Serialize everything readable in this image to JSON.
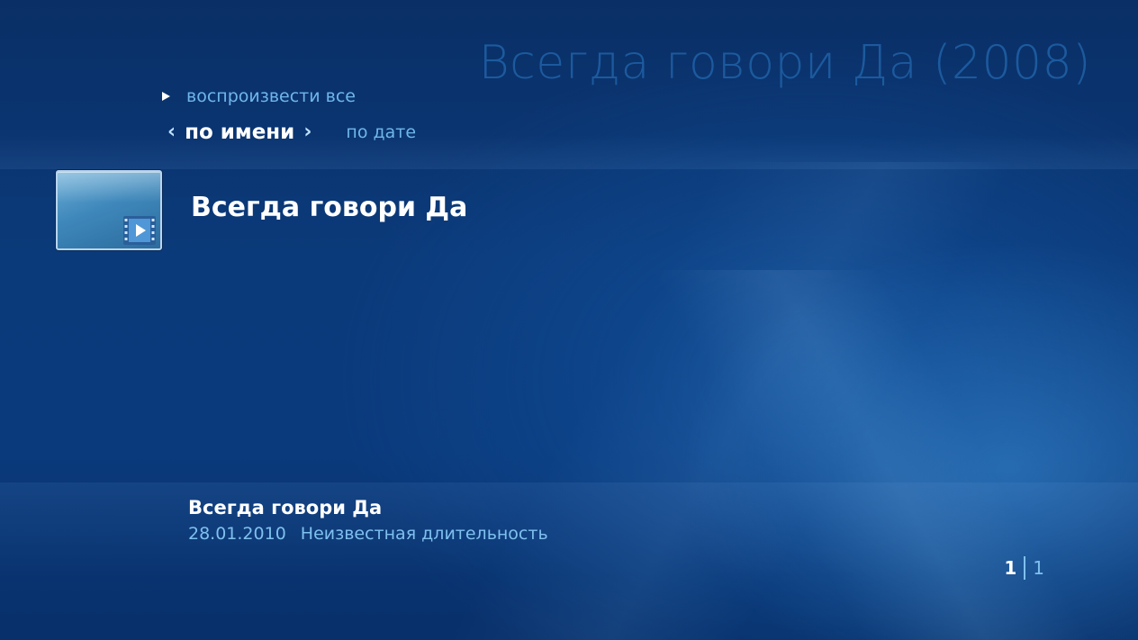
{
  "header": {
    "title": "Всегда говори Да (2008)"
  },
  "actions": {
    "play_all": "воспроизвести все"
  },
  "sort": {
    "active": "по имени",
    "options": [
      "по имени",
      "по дате"
    ],
    "other": "по дате"
  },
  "items": [
    {
      "title": "Всегда говори Да",
      "icon": "video-file-icon"
    }
  ],
  "details": {
    "title": "Всегда говори Да",
    "date": "28.01.2010",
    "duration": "Неизвестная длительность"
  },
  "pager": {
    "current": "1",
    "total": "1"
  },
  "colors": {
    "background": "#0b3a7a",
    "title_faint": "#1c5a9e",
    "accent_text": "#6fb6ea",
    "meta_text": "#7fc0ee"
  }
}
